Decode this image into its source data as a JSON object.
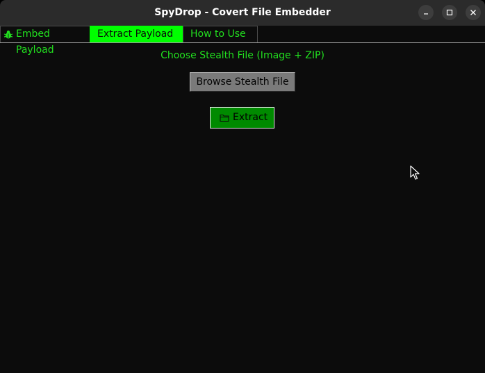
{
  "window": {
    "title": "SpyDrop - Covert File Embedder",
    "controls": {
      "minimize_icon": "minimize-icon",
      "maximize_icon": "maximize-icon",
      "close_icon": "close-icon"
    }
  },
  "tabs": [
    {
      "label": "Embed Payload",
      "icon": "bug-icon",
      "selected": false
    },
    {
      "label": "Extract Payload",
      "selected": true
    },
    {
      "label": "How to Use",
      "selected": false
    }
  ],
  "main": {
    "choose_label": "Choose Stealth File (Image + ZIP)",
    "browse_button": "Browse Stealth File",
    "extract_button": "Extract",
    "extract_icon": "folder-icon"
  },
  "colors": {
    "accent": "#00ff00",
    "text_green": "#22e01f",
    "background": "#0c0c0c",
    "titlebar": "#2b2b2b",
    "extract_button_bg": "#008a00",
    "browse_button_bg": "#7a7a7a"
  }
}
